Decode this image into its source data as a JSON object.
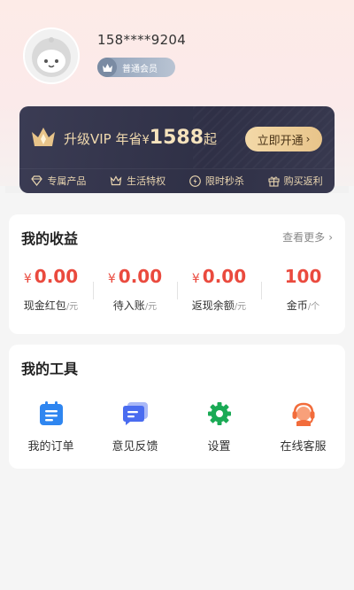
{
  "profile": {
    "phone": "158****9204",
    "member_level": "普通会员"
  },
  "vip_banner": {
    "title": "升级VIP  年省",
    "currency": "¥",
    "price": "1588",
    "suffix": "起",
    "open_button": "立即开通",
    "perks": [
      {
        "label": "专属产品",
        "icon": "diamond-icon"
      },
      {
        "label": "生活特权",
        "icon": "crown-icon"
      },
      {
        "label": "限时秒杀",
        "icon": "lightning-icon"
      },
      {
        "label": "购买返利",
        "icon": "gift-icon"
      }
    ]
  },
  "earnings": {
    "title": "我的收益",
    "more_label": "查看更多",
    "items": [
      {
        "currency": "¥",
        "value": "0.00",
        "label": "现金红包",
        "unit": "/元"
      },
      {
        "currency": "¥",
        "value": "0.00",
        "label": "待入账",
        "unit": "/元"
      },
      {
        "currency": "¥",
        "value": "0.00",
        "label": "返现余额",
        "unit": "/元"
      },
      {
        "currency": "",
        "value": "100",
        "label": "金币",
        "unit": "/个"
      }
    ]
  },
  "tools": {
    "title": "我的工具",
    "items": [
      {
        "label": "我的订单",
        "icon": "order-list-icon"
      },
      {
        "label": "意见反馈",
        "icon": "feedback-icon"
      },
      {
        "label": "设置",
        "icon": "gear-icon"
      },
      {
        "label": "在线客服",
        "icon": "customer-service-icon"
      }
    ]
  },
  "colors": {
    "accent_red": "#ea4a3e",
    "vip_gold": "#f0d9ae",
    "vip_card_bg": "#2f3046",
    "order_icon_blue": "#2f86f0",
    "feedback_icon_blue": "#4a6cf0",
    "settings_icon_green": "#1aaa55",
    "service_icon_orange": "#f26c3b"
  }
}
